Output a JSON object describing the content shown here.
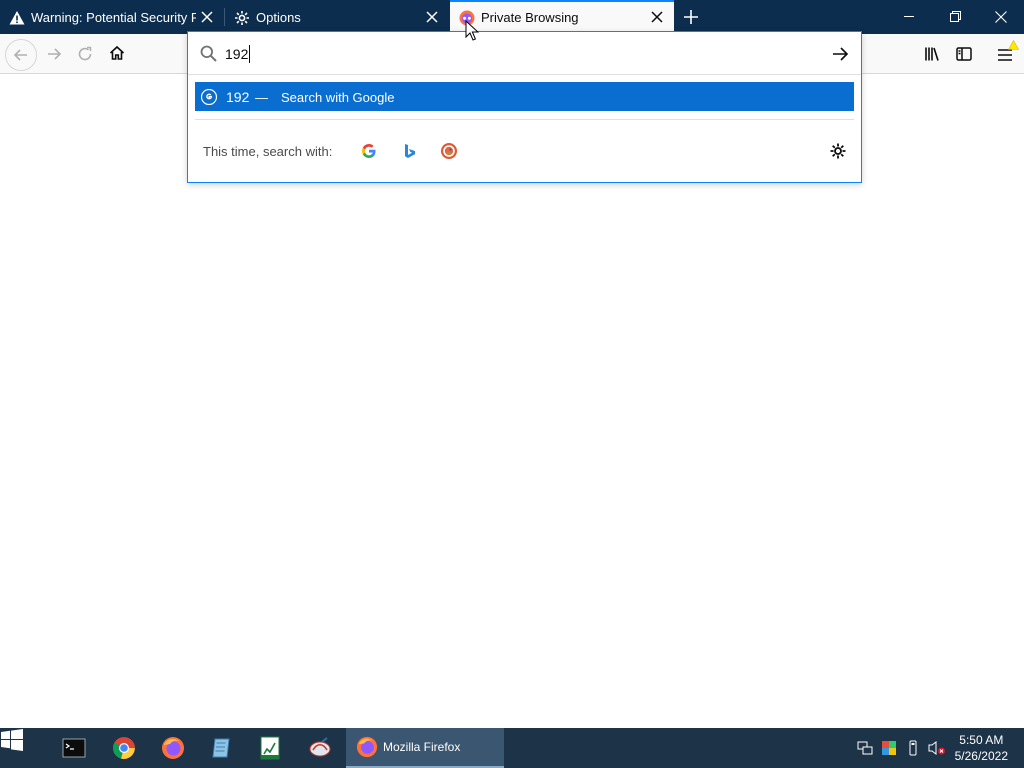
{
  "tabs": [
    {
      "title": "Warning: Potential Security Risk Ahead",
      "icon": "warning-icon",
      "active": false
    },
    {
      "title": "Options",
      "icon": "gear-icon",
      "active": false
    },
    {
      "title": "Private Browsing",
      "icon": "private-browsing-icon",
      "active": true
    }
  ],
  "urlbar": {
    "value": "192",
    "result": {
      "query": "192",
      "dash": "—",
      "action": "Search with Google"
    },
    "one_off_label": "This time, search with:",
    "engines": [
      "Google",
      "Bing",
      "DuckDuckGo"
    ]
  },
  "taskbar": {
    "active_label": "Mozilla Firefox",
    "time": "5:50 AM",
    "date": "5/26/2022"
  },
  "colors": {
    "accent": "#0a84ff",
    "selected_result": "#0a6ed1",
    "tabstrip": "#0c2d4e",
    "taskbar": "#1c3348"
  }
}
